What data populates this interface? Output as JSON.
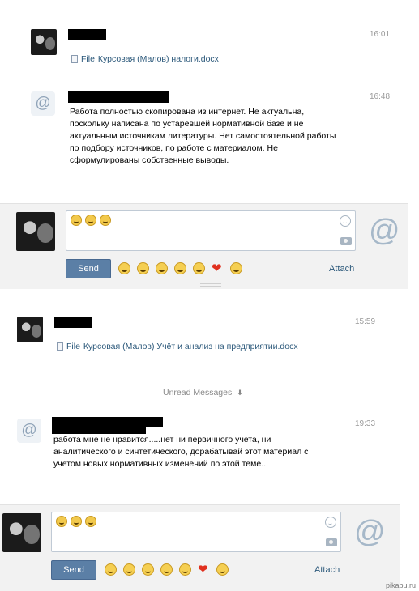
{
  "top": {
    "msg1": {
      "time": "16:01",
      "file_prefix": "File",
      "file_name": "Курсовая (Малов) налоги.docx"
    },
    "msg2": {
      "time": "16:48",
      "text": "Работа полностью скопирована из интернет. Не актуальна,\nпоскольку написана по устаревшей нормативной базе и не\nактуальным источникам литературы. Нет самостоятельной работы\nпо подбору источников, по работе с материалом. Не\nсформулированы собственные выводы."
    },
    "compose": {
      "send_label": "Send",
      "attach_label": "Attach"
    }
  },
  "bottom": {
    "msg1": {
      "time": "15:59",
      "file_prefix": "File",
      "file_name": "Курсовая (Малов) Учёт и анализ на предприятии.docx"
    },
    "unread_label": "Unread Messages",
    "msg2": {
      "time": "19:33",
      "text": "работа мне не нравится.....нет ни первичного учета, ни\nаналитического и синтетического,  дорабатывай этот материал с\nучетом новых нормативных изменений по этой теме..."
    },
    "compose": {
      "send_label": "Send",
      "attach_label": "Attach"
    }
  },
  "watermark": "pikabu.ru",
  "icons": {
    "at": "@",
    "arrow_down": "⬇"
  },
  "colors": {
    "accent": "#5b7fa6",
    "link": "#2b587a",
    "compose_bg": "#f2f2f2"
  }
}
